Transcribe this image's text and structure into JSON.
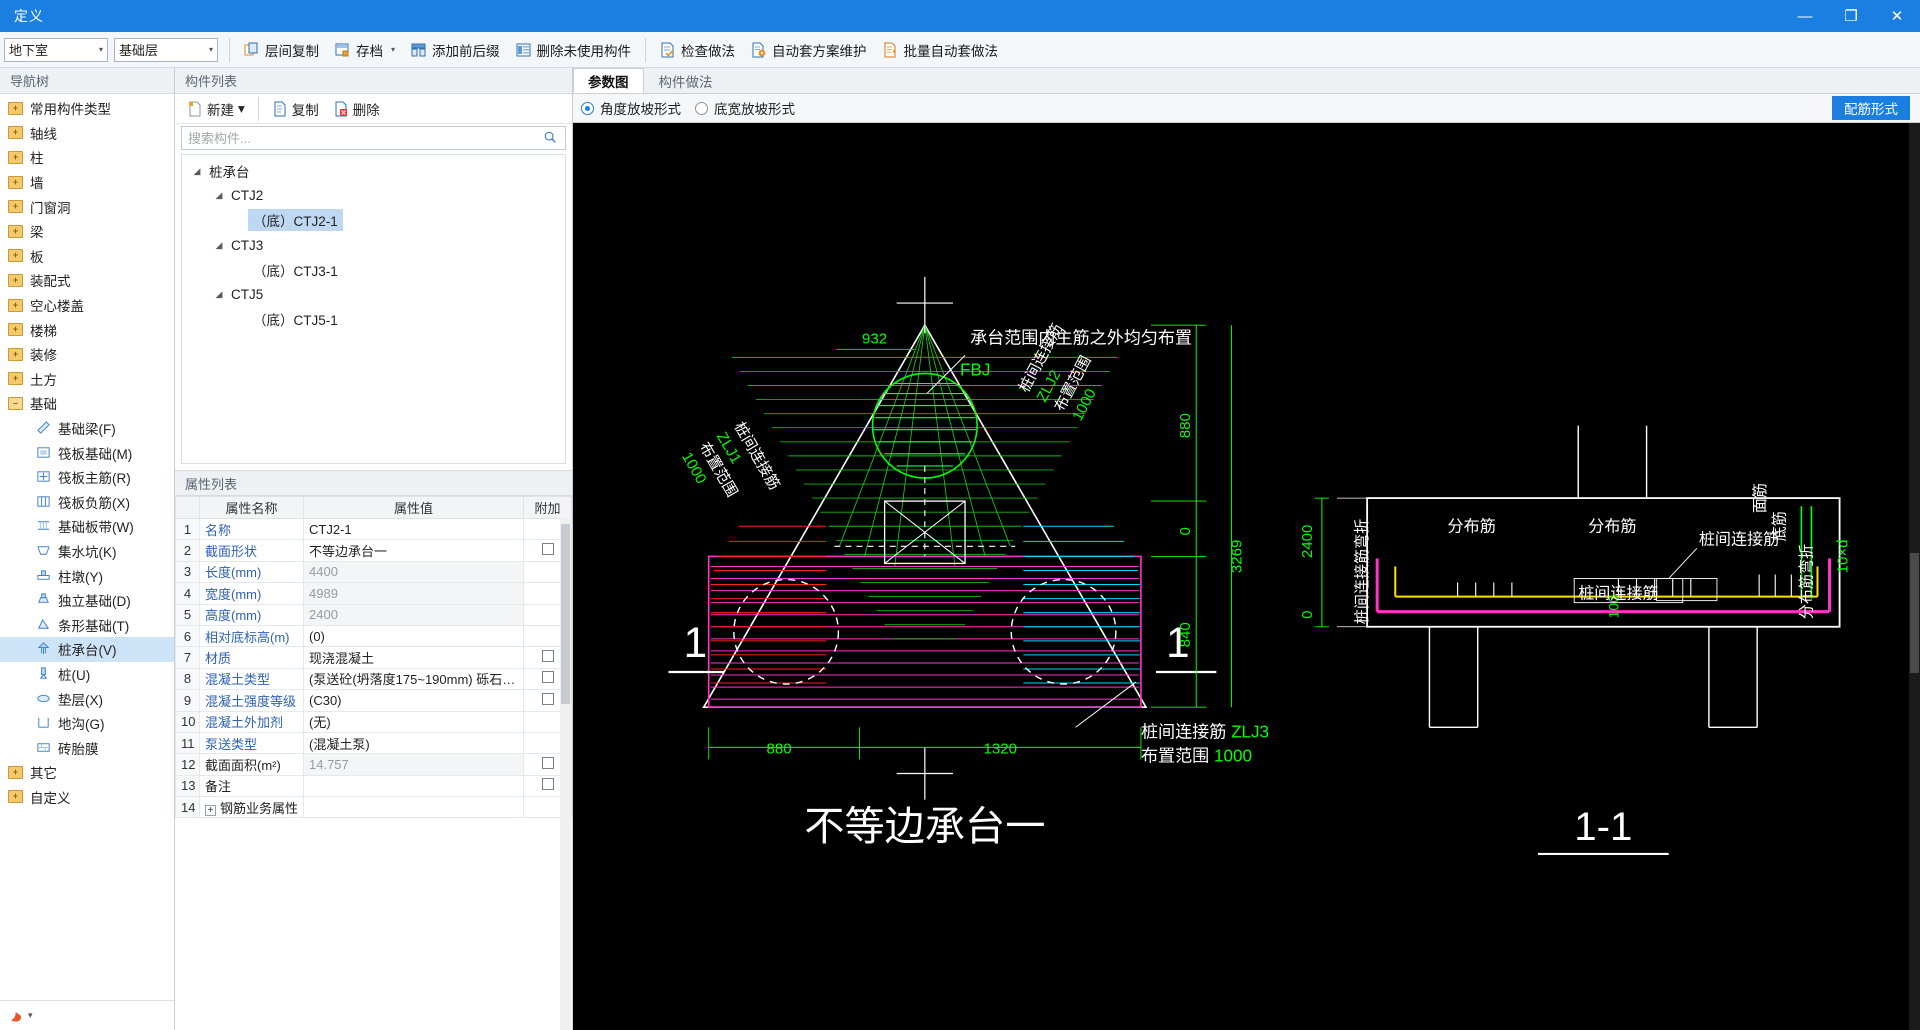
{
  "window": {
    "title": "定义",
    "minimize": "—",
    "maximize": "❐",
    "close": "✕"
  },
  "toolbar": {
    "floor_combo": {
      "value": "地下室",
      "caret": "▾"
    },
    "layer_combo": {
      "value": "基础层",
      "caret": "▾"
    },
    "buttons": [
      {
        "label": "层间复制",
        "icon": "copy-between-floors-icon",
        "caret": ""
      },
      {
        "label": "存档",
        "icon": "archive-icon",
        "caret": "▾"
      },
      {
        "label": "添加前后缀",
        "icon": "add-affix-icon",
        "caret": ""
      },
      {
        "label": "删除未使用构件",
        "icon": "delete-unused-icon",
        "caret": ""
      },
      {
        "label": "检查做法",
        "icon": "check-method-icon",
        "caret": ""
      },
      {
        "label": "自动套方案维护",
        "icon": "auto-scheme-icon",
        "caret": ""
      },
      {
        "label": "批量自动套做法",
        "icon": "batch-auto-icon",
        "caret": ""
      }
    ]
  },
  "nav": {
    "header": "导航树",
    "items": [
      {
        "label": "常用构件类型",
        "type": "folder"
      },
      {
        "label": "轴线",
        "type": "folder"
      },
      {
        "label": "柱",
        "type": "folder"
      },
      {
        "label": "墙",
        "type": "folder"
      },
      {
        "label": "门窗洞",
        "type": "folder"
      },
      {
        "label": "梁",
        "type": "folder"
      },
      {
        "label": "板",
        "type": "folder"
      },
      {
        "label": "装配式",
        "type": "folder"
      },
      {
        "label": "空心楼盖",
        "type": "folder"
      },
      {
        "label": "楼梯",
        "type": "folder"
      },
      {
        "label": "装修",
        "type": "folder"
      },
      {
        "label": "土方",
        "type": "folder"
      },
      {
        "label": "基础",
        "type": "folder-open"
      },
      {
        "label": "基础梁(F)",
        "type": "leaf",
        "icon": "foundation-beam-icon"
      },
      {
        "label": "筏板基础(M)",
        "type": "leaf",
        "icon": "raft-foundation-icon"
      },
      {
        "label": "筏板主筋(R)",
        "type": "leaf",
        "icon": "raft-main-rebar-icon"
      },
      {
        "label": "筏板负筋(X)",
        "type": "leaf",
        "icon": "raft-negative-rebar-icon"
      },
      {
        "label": "基础板带(W)",
        "type": "leaf",
        "icon": "foundation-slab-band-icon"
      },
      {
        "label": "集水坑(K)",
        "type": "leaf",
        "icon": "sump-pit-icon"
      },
      {
        "label": "柱墩(Y)",
        "type": "leaf",
        "icon": "column-pier-icon"
      },
      {
        "label": "独立基础(D)",
        "type": "leaf",
        "icon": "isolated-foundation-icon"
      },
      {
        "label": "条形基础(T)",
        "type": "leaf",
        "icon": "strip-foundation-icon"
      },
      {
        "label": "桩承台(V)",
        "type": "leaf",
        "icon": "pile-cap-icon",
        "selected": true
      },
      {
        "label": "桩(U)",
        "type": "leaf",
        "icon": "pile-icon"
      },
      {
        "label": "垫层(X)",
        "type": "leaf",
        "icon": "cushion-icon"
      },
      {
        "label": "地沟(G)",
        "type": "leaf",
        "icon": "trench-icon"
      },
      {
        "label": "砖胎膜",
        "type": "leaf",
        "icon": "brick-mold-icon"
      },
      {
        "label": "其它",
        "type": "folder"
      },
      {
        "label": "自定义",
        "type": "folder"
      }
    ],
    "footer_caret": "▾"
  },
  "components": {
    "header": "构件列表",
    "buttons": [
      {
        "label": "新建",
        "icon": "new-icon",
        "caret": "▾"
      },
      {
        "label": "复制",
        "icon": "copy-icon",
        "caret": ""
      },
      {
        "label": "删除",
        "icon": "delete-icon",
        "caret": ""
      }
    ],
    "search_placeholder": "搜索构件...",
    "search_value": "",
    "search_icon": "search-icon",
    "tree": [
      {
        "label": "桩承台",
        "depth": 0,
        "arrow": "◢"
      },
      {
        "label": "CTJ2",
        "depth": 1,
        "arrow": "◢"
      },
      {
        "label": "（底）CTJ2-1",
        "depth": 2,
        "arrow": "",
        "selected": true
      },
      {
        "label": "CTJ3",
        "depth": 1,
        "arrow": "◢"
      },
      {
        "label": "（底）CTJ3-1",
        "depth": 2,
        "arrow": ""
      },
      {
        "label": "CTJ5",
        "depth": 1,
        "arrow": "◢"
      },
      {
        "label": "（底）CTJ5-1",
        "depth": 2,
        "arrow": ""
      }
    ]
  },
  "properties": {
    "header": "属性列表",
    "columns": [
      "",
      "属性名称",
      "属性值",
      "附加"
    ],
    "rows": [
      {
        "n": "1",
        "name": "名称",
        "value": "CTJ2-1",
        "link": true,
        "grey": false,
        "check": false
      },
      {
        "n": "2",
        "name": "截面形状",
        "value": "不等边承台一",
        "link": true,
        "grey": false,
        "check": true
      },
      {
        "n": "3",
        "name": "长度(mm)",
        "value": "4400",
        "link": true,
        "grey": true,
        "check": false
      },
      {
        "n": "4",
        "name": "宽度(mm)",
        "value": "4989",
        "link": true,
        "grey": true,
        "check": false
      },
      {
        "n": "5",
        "name": "高度(mm)",
        "value": "2400",
        "link": true,
        "grey": true,
        "check": false
      },
      {
        "n": "6",
        "name": "相对底标高(m)",
        "value": "(0)",
        "link": true,
        "grey": false,
        "check": false
      },
      {
        "n": "7",
        "name": "材质",
        "value": "现浇混凝土",
        "link": true,
        "grey": false,
        "check": true
      },
      {
        "n": "8",
        "name": "混凝土类型",
        "value": "(泵送砼(坍落度175~190mm) 砾石…",
        "link": true,
        "grey": false,
        "check": true
      },
      {
        "n": "9",
        "name": "混凝土强度等级",
        "value": "(C30)",
        "link": true,
        "grey": false,
        "check": true
      },
      {
        "n": "10",
        "name": "混凝土外加剂",
        "value": "(无)",
        "link": true,
        "grey": false,
        "check": false
      },
      {
        "n": "11",
        "name": "泵送类型",
        "value": "(混凝土泵)",
        "link": true,
        "grey": false,
        "check": false
      },
      {
        "n": "12",
        "name": "截面面积(m²)",
        "value": "14.757",
        "link": false,
        "grey": true,
        "check": true
      },
      {
        "n": "13",
        "name": "备注",
        "value": "",
        "link": false,
        "grey": false,
        "check": true
      },
      {
        "n": "14",
        "name": "钢筋业务属性",
        "value": "",
        "link": false,
        "grey": false,
        "check": false,
        "expander": "+"
      }
    ]
  },
  "rightpanel": {
    "tabs": [
      {
        "label": "参数图",
        "active": true
      },
      {
        "label": "构件做法",
        "active": false
      }
    ],
    "radios": [
      {
        "label": "角度放坡形式",
        "checked": true
      },
      {
        "label": "底宽放坡形式",
        "checked": false
      }
    ],
    "rebar_button": "配筋形式"
  },
  "drawing": {
    "title": "不等边承台一",
    "section_label": "1-1",
    "marker_left": "1",
    "marker_right": "1",
    "labels": [
      {
        "text": "承台范围内主筋之外均匀布置",
        "color": "#ffffff"
      },
      {
        "text": "FBJ",
        "color": "#00ff00"
      },
      {
        "text": "932",
        "color": "#00ff00"
      },
      {
        "text": "880",
        "color": "#00ff00"
      },
      {
        "text": "3269",
        "color": "#00ff00"
      },
      {
        "text": "0",
        "color": "#00ff00"
      },
      {
        "text": "840",
        "color": "#00ff00"
      },
      {
        "text": "880",
        "color": "#00ff00"
      },
      {
        "text": "1320",
        "color": "#00ff00"
      },
      {
        "text": "桩间连接筋",
        "color": "#ffffff"
      },
      {
        "text": "ZLJ1",
        "color": "#00ff00"
      },
      {
        "text": "布置范围",
        "color": "#ffffff"
      },
      {
        "text": "1000",
        "color": "#00ff00"
      },
      {
        "text": "桩间连接筋",
        "color": "#ffffff"
      },
      {
        "text": "ZLJ2",
        "color": "#00ff00"
      },
      {
        "text": "布置范围",
        "color": "#ffffff"
      },
      {
        "text": "1000",
        "color": "#00ff00"
      },
      {
        "text": "桩间连接筋",
        "color": "#ffffff"
      },
      {
        "text": "ZLJ3",
        "color": "#00ff00"
      },
      {
        "text": "布置范围",
        "color": "#ffffff"
      },
      {
        "text": "1000",
        "color": "#00ff00"
      },
      {
        "text": "分布筋",
        "color": "#ffffff"
      },
      {
        "text": "分布筋",
        "color": "#ffffff"
      },
      {
        "text": "桩间连接筋",
        "color": "#ffffff"
      },
      {
        "text": "桩间连接筋",
        "color": "#ffffff"
      },
      {
        "text": "桩间连接筋弯折",
        "color": "#ffffff"
      },
      {
        "text": "分布筋弯折",
        "color": "#ffffff"
      },
      {
        "text": "面筋",
        "color": "#ffffff"
      },
      {
        "text": "底筋",
        "color": "#ffffff"
      },
      {
        "text": "2400",
        "color": "#00ff00"
      },
      {
        "text": "0",
        "color": "#00ff00"
      },
      {
        "text": "100",
        "color": "#00ff00"
      },
      {
        "text": "10×d",
        "color": "#00ff00"
      }
    ]
  }
}
